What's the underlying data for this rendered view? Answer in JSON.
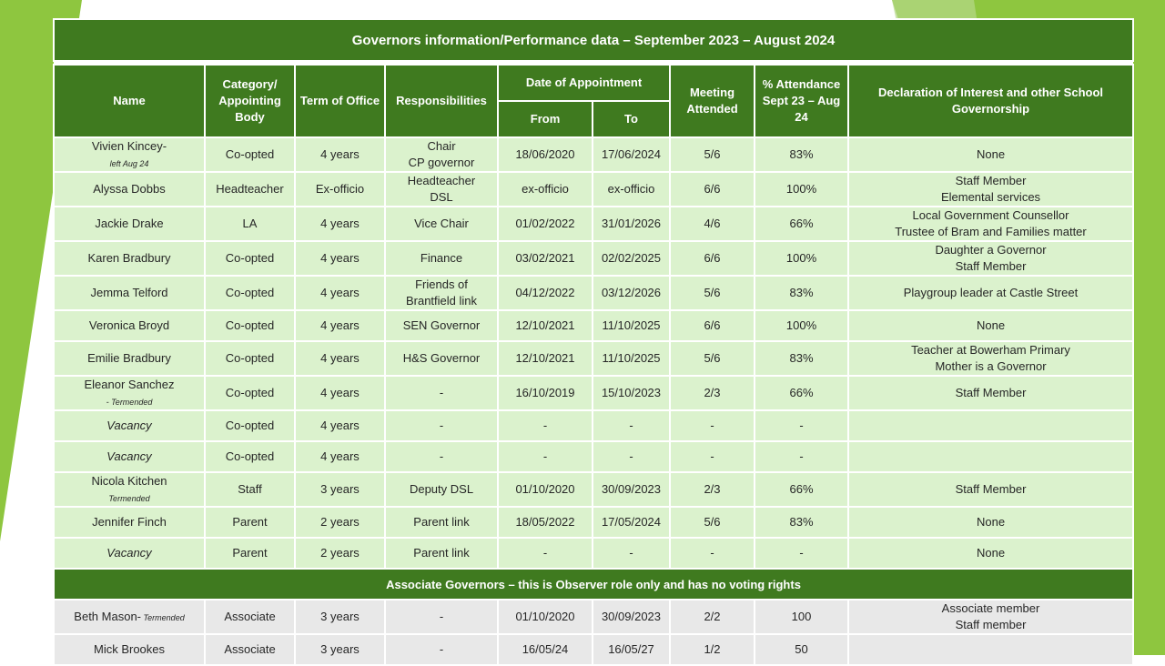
{
  "title": "Governors information/Performance data – September 2023 – August 2024",
  "headers": {
    "name": "Name",
    "category": "Category/ Appointing Body",
    "term": "Term of Office",
    "responsibilities": "Responsibilities",
    "date_of_appointment": "Date of Appointment",
    "from": "From",
    "to": "To",
    "meeting": "Meeting Attended",
    "attendance": "% Attendance Sept 23 – Aug 24",
    "declaration": "Declaration of Interest and other School Governorship"
  },
  "governors": [
    {
      "name": "Vivien Kincey-",
      "note": "left Aug 24",
      "category": "Co-opted",
      "term": "4 years",
      "resp": "Chair",
      "resp2": "CP governor",
      "from": "18/06/2020",
      "to": "17/06/2024",
      "meeting": "5/6",
      "pct": "83%",
      "decl": "None",
      "decl2": ""
    },
    {
      "name": "Alyssa Dobbs",
      "note": "",
      "category": "Headteacher",
      "term": "Ex-officio",
      "resp": "Headteacher",
      "resp2": "DSL",
      "from": "ex-officio",
      "to": "ex-officio",
      "meeting": "6/6",
      "pct": "100%",
      "decl": "Staff Member",
      "decl2": "Elemental services"
    },
    {
      "name": "Jackie Drake",
      "note": "",
      "category": "LA",
      "term": "4 years",
      "resp": "Vice Chair",
      "resp2": "",
      "from": "01/02/2022",
      "to": "31/01/2026",
      "meeting": "4/6",
      "pct": "66%",
      "decl": "Local Government Counsellor",
      "decl2": "Trustee of Bram and Families matter"
    },
    {
      "name": "Karen Bradbury",
      "note": "",
      "category": "Co-opted",
      "term": "4 years",
      "resp": "Finance",
      "resp2": "",
      "from": "03/02/2021",
      "to": "02/02/2025",
      "meeting": "6/6",
      "pct": "100%",
      "decl": "Daughter a Governor",
      "decl2": "Staff Member"
    },
    {
      "name": "Jemma Telford",
      "note": "",
      "category": "Co-opted",
      "term": "4 years",
      "resp": "Friends of",
      "resp2": "Brantfield link",
      "from": "04/12/2022",
      "to": "03/12/2026",
      "meeting": "5/6",
      "pct": "83%",
      "decl": "Playgroup leader at Castle Street",
      "decl2": ""
    },
    {
      "name": "Veronica Broyd",
      "note": "",
      "category": "Co-opted",
      "term": "4 years",
      "resp": "SEN Governor",
      "resp2": "",
      "from": "12/10/2021",
      "to": "11/10/2025",
      "meeting": "6/6",
      "pct": "100%",
      "decl": "None",
      "decl2": ""
    },
    {
      "name": "Emilie Bradbury",
      "note": "",
      "category": "Co-opted",
      "term": "4 years",
      "resp": "H&S  Governor",
      "resp2": "",
      "from": "12/10/2021",
      "to": "11/10/2025",
      "meeting": "5/6",
      "pct": "83%",
      "decl": "Teacher  at Bowerham Primary",
      "decl2": "Mother is a Governor"
    },
    {
      "name": "Eleanor Sanchez",
      "note": "- Termended",
      "category": "Co-opted",
      "term": "4 years",
      "resp": "-",
      "resp2": "",
      "from": "16/10/2019",
      "to": "15/10/2023",
      "meeting": "2/3",
      "pct": "66%",
      "decl": "Staff Member",
      "decl2": ""
    },
    {
      "name": "Vacancy",
      "note": "",
      "category": "Co-opted",
      "term": "4 years",
      "resp": "-",
      "resp2": "",
      "from": "-",
      "to": "-",
      "meeting": "-",
      "pct": "-",
      "decl": "",
      "decl2": ""
    },
    {
      "name": "Vacancy",
      "note": "",
      "category": "Co-opted",
      "term": "4 years",
      "resp": "-",
      "resp2": "",
      "from": "-",
      "to": "-",
      "meeting": "-",
      "pct": "-",
      "decl": "",
      "decl2": ""
    },
    {
      "name": "Nicola Kitchen",
      "note": "Termended",
      "category": "Staff",
      "term": "3 years",
      "resp": "Deputy DSL",
      "resp2": "",
      "from": "01/10/2020",
      "to": "30/09/2023",
      "meeting": "2/3",
      "pct": "66%",
      "decl": "Staff Member",
      "decl2": ""
    },
    {
      "name": "Jennifer Finch",
      "note": "",
      "category": "Parent",
      "term": "2 years",
      "resp": "Parent link",
      "resp2": "",
      "from": "18/05/2022",
      "to": "17/05/2024",
      "meeting": "5/6",
      "pct": "83%",
      "decl": "None",
      "decl2": ""
    },
    {
      "name": "Vacancy",
      "note": "",
      "category": "Parent",
      "term": "2 years",
      "resp": "Parent link",
      "resp2": "",
      "from": "-",
      "to": "-",
      "meeting": "-",
      "pct": "-",
      "decl": "None",
      "decl2": ""
    }
  ],
  "associate_heading": "Associate Governors – this is Observer role only and has no voting rights",
  "associates": [
    {
      "name": "Beth Mason-",
      "note": "Termended",
      "category": "Associate",
      "term": "3 years",
      "resp": "-",
      "from": "01/10/2020",
      "to": "30/09/2023",
      "meeting": "2/2",
      "pct": "100",
      "decl": "Associate member",
      "decl2": "Staff member"
    },
    {
      "name": "Mick Brookes",
      "note": "",
      "category": "Associate",
      "term": "3 years",
      "resp": "-",
      "from": "16/05/24",
      "to": "16/05/27",
      "meeting": "1/2",
      "pct": "50",
      "decl": "",
      "decl2": ""
    }
  ]
}
